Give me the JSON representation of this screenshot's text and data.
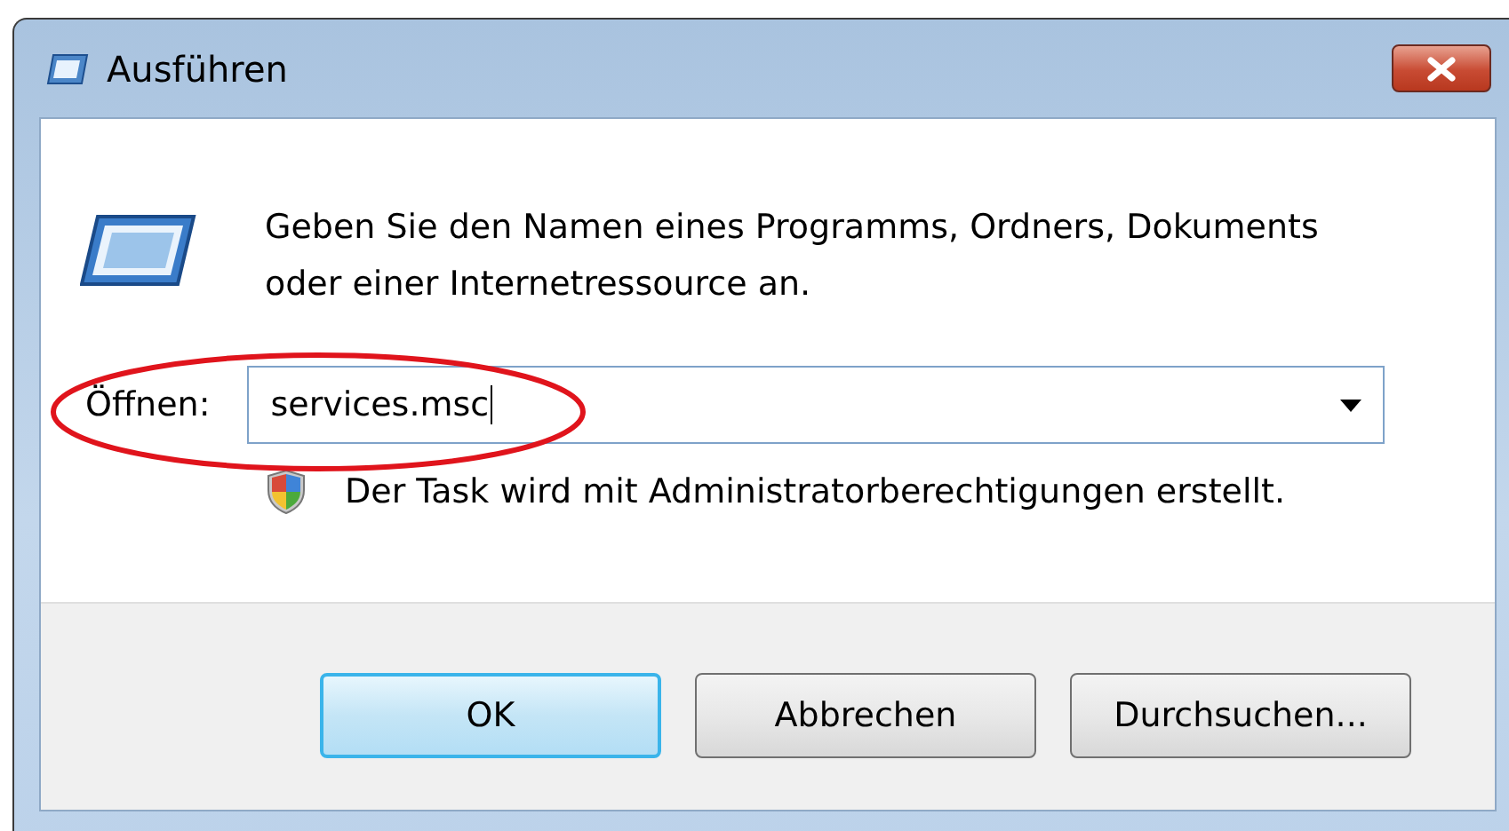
{
  "window": {
    "title": "Ausführen"
  },
  "description": "Geben Sie den Namen eines Programms, Ordners, Dokuments oder einer Internetressource an.",
  "open_field": {
    "label": "Öffnen:",
    "value": "services.msc",
    "highlighted": true
  },
  "admin_note": "Der Task wird mit Administratorberechtigungen erstellt.",
  "buttons": [
    {
      "label": "OK",
      "default": true
    },
    {
      "label": "Abbrechen",
      "default": false
    },
    {
      "label": "Durchsuchen...",
      "default": false
    }
  ]
}
